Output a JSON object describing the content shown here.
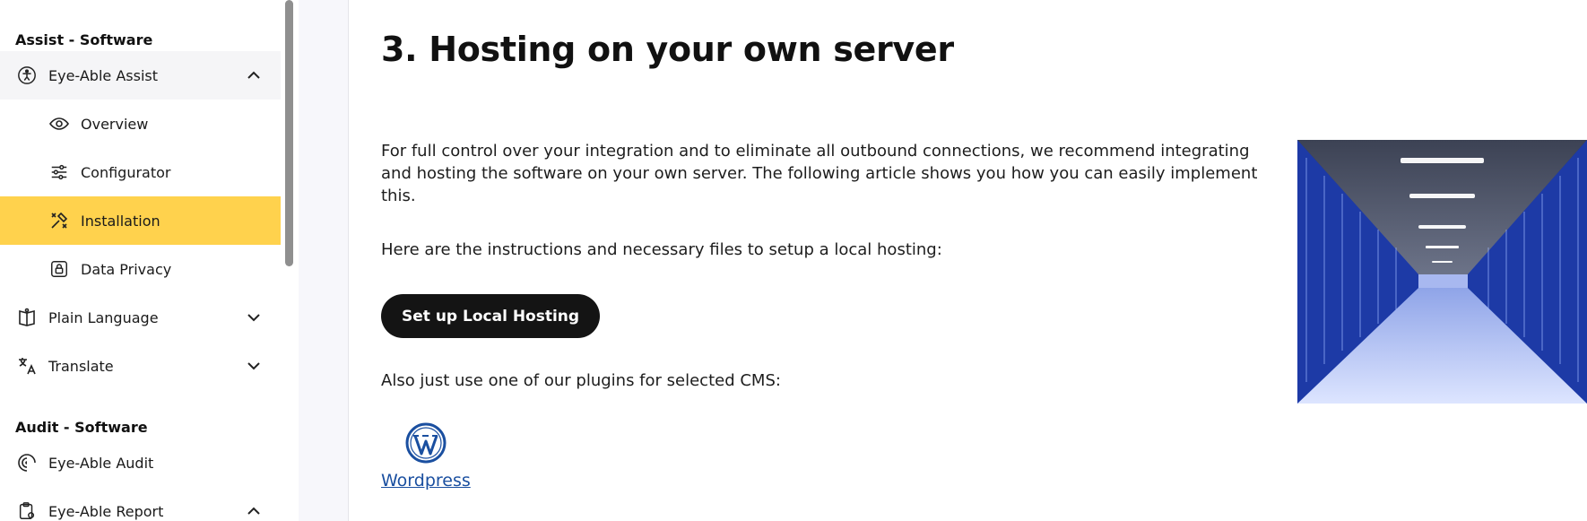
{
  "sidebar": {
    "sections": [
      {
        "title": "Assist - Software"
      },
      {
        "title": "Audit - Software"
      }
    ],
    "items": [
      {
        "label": "Eye-Able Assist",
        "icon": "accessibility-icon"
      },
      {
        "label": "Overview",
        "icon": "eye-icon"
      },
      {
        "label": "Configurator",
        "icon": "sliders-icon"
      },
      {
        "label": "Installation",
        "icon": "tools-icon"
      },
      {
        "label": "Data Privacy",
        "icon": "lock-icon"
      },
      {
        "label": "Plain Language",
        "icon": "book-icon"
      },
      {
        "label": "Translate",
        "icon": "translate-icon"
      },
      {
        "label": "Eye-Able Audit",
        "icon": "audit-icon"
      },
      {
        "label": "Eye-Able Report",
        "icon": "report-icon"
      }
    ]
  },
  "main": {
    "title": "3. Hosting on your own server",
    "paragraph1": "For full control over your integration and to eliminate all outbound connections, we recommend integrating and hosting the software on your own server. The following article shows you how you can easily implement this.",
    "paragraph2": "Here are the instructions and necessary files to setup a local hosting:",
    "button_label": "Set up Local Hosting",
    "paragraph3": "Also just use one of our plugins for selected CMS:",
    "plugin_link": "Wordpress"
  },
  "colors": {
    "active_bg": "#ffd24d",
    "button_bg": "#141414",
    "link": "#1a4fa0"
  }
}
